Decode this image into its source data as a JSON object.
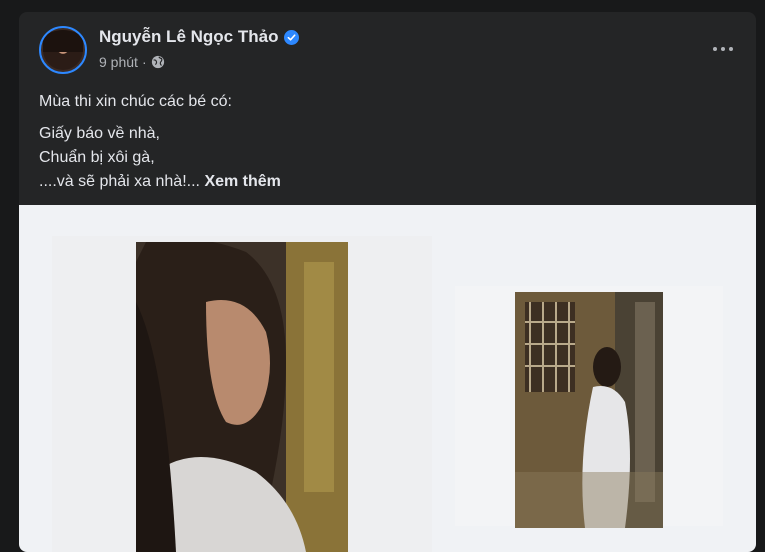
{
  "post": {
    "author": "Nguyễn Lê Ngọc Thảo",
    "time": "9 phút",
    "separator": "·",
    "caption_line1": "Mùa thi xin chúc các bé có:",
    "caption_line2": "Giấy báo về nhà,",
    "caption_line3": "Chuẩn bị xôi gà,",
    "caption_line4": "....và sẽ phải xa nhà!...",
    "see_more": "Xem thêm"
  },
  "icons": {
    "verified": "verified-badge-icon",
    "privacy": "globe-icon",
    "more": "more-options-icon"
  },
  "colors": {
    "background": "#18191a",
    "card": "#242526",
    "text_primary": "#e4e6eb",
    "text_secondary": "#b0b3b8",
    "accent": "#2d88ff"
  }
}
